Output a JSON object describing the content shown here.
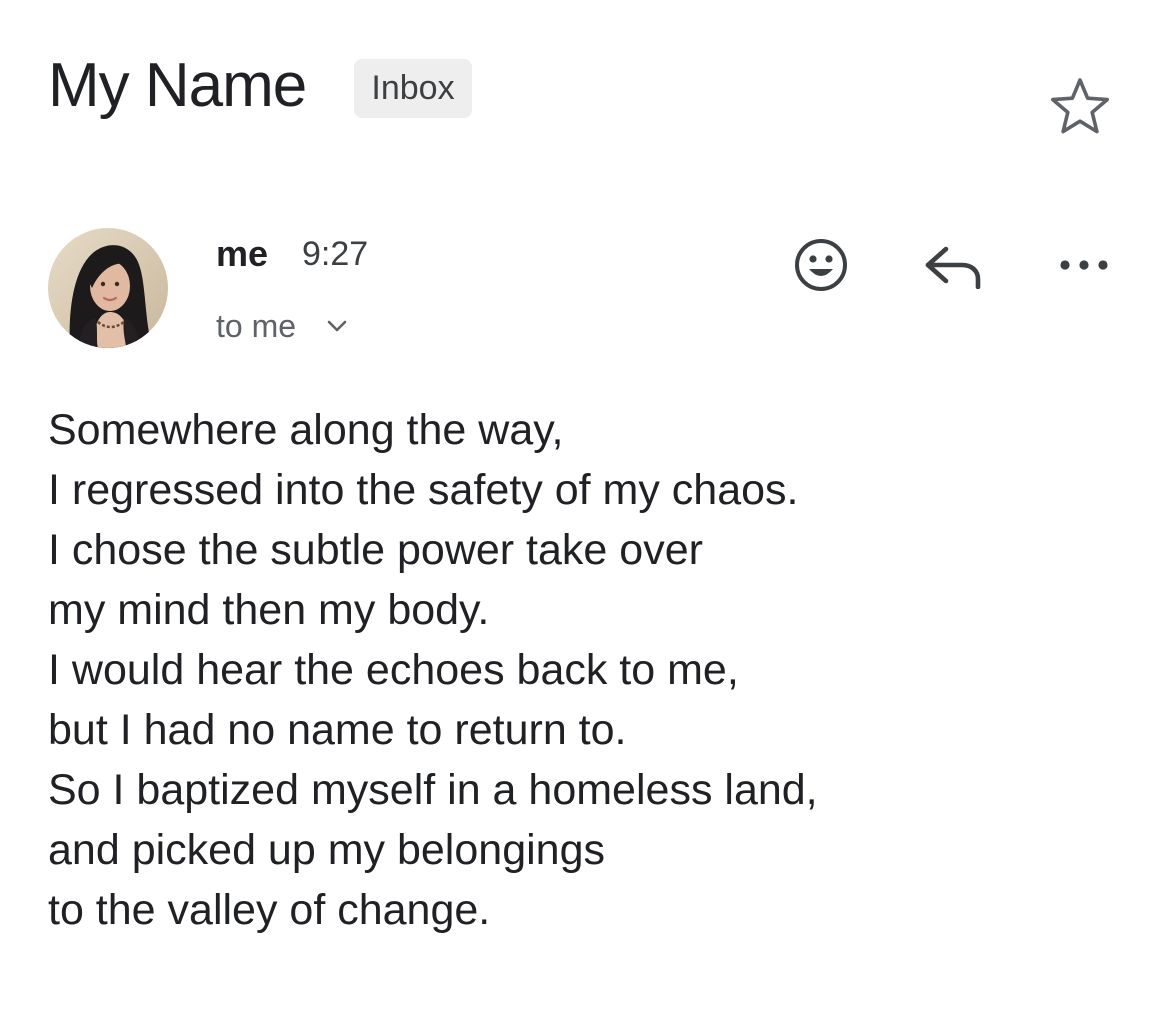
{
  "email": {
    "subject": "My Name",
    "label": "Inbox",
    "star": {
      "icon": "star-outline-icon",
      "starred": false
    },
    "sender": {
      "name": "me",
      "time": "9:27",
      "recipients": "to me",
      "avatar_icon": "profile-photo"
    },
    "actions": [
      {
        "name": "emoji-reaction",
        "icon": "smiley-icon"
      },
      {
        "name": "reply",
        "icon": "reply-arrow-icon"
      },
      {
        "name": "more-options",
        "icon": "more-horizontal-icon"
      }
    ],
    "body_lines": [
      "Somewhere along the way,",
      "I regressed into the safety of my chaos.",
      "I chose the subtle power take over",
      "my mind then my body.",
      "I would hear the echoes back to me,",
      "but I had no name to return to.",
      "So I baptized myself in a homeless land,",
      "and picked up my belongings",
      "to the valley of change."
    ]
  },
  "colors": {
    "text_primary": "#202124",
    "text_secondary": "#5f6368",
    "chip_background": "#eeeeee",
    "icon_color": "#3c4043"
  }
}
